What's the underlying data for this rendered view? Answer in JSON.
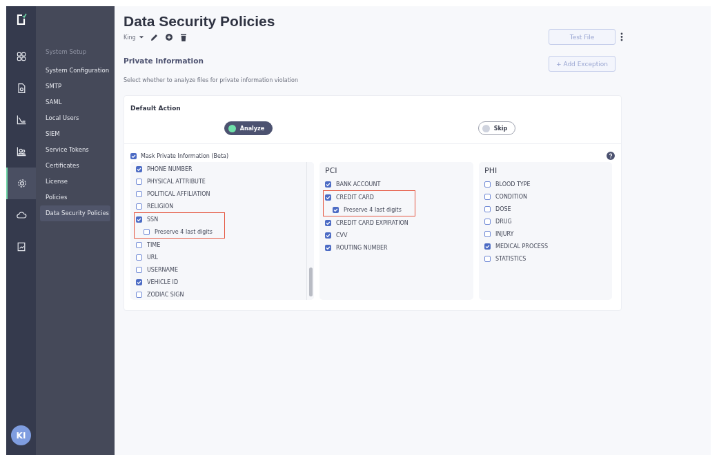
{
  "nav_rail": {
    "items": [
      {
        "selected": false
      },
      {
        "selected": false
      },
      {
        "selected": false
      },
      {
        "selected": false
      },
      {
        "selected": true
      },
      {
        "selected": false
      },
      {
        "selected": false
      }
    ],
    "avatar": "KI"
  },
  "sidebar": {
    "heading": "System Setup",
    "items": [
      {
        "label": "System Configuration",
        "selected": false
      },
      {
        "label": "SMTP",
        "selected": false
      },
      {
        "label": "SAML",
        "selected": false
      },
      {
        "label": "Local Users",
        "selected": false
      },
      {
        "label": "SIEM",
        "selected": false
      },
      {
        "label": "Service Tokens",
        "selected": false
      },
      {
        "label": "Certificates",
        "selected": false
      },
      {
        "label": "License",
        "selected": false
      },
      {
        "label": "Policies",
        "selected": false
      },
      {
        "label": "Data Security Policies",
        "selected": true
      }
    ]
  },
  "page": {
    "title": "Data Security Policies",
    "policy": "King",
    "buttons": {
      "test_file": "Test File",
      "add_exception": "+ Add Exception"
    }
  },
  "section": {
    "title": "Private Information",
    "description": "Select whether to analyze files for private information violation"
  },
  "default_action": {
    "title": "Default Action",
    "options": [
      {
        "label": "Analyze",
        "selected": true
      },
      {
        "label": "Skip",
        "selected": false
      }
    ]
  },
  "mask": {
    "label": "Mask Private Information (Beta)",
    "checked": true
  },
  "groups": [
    {
      "items": [
        {
          "label": "PHONE NUMBER",
          "checked": true,
          "highlighted": false
        },
        {
          "label": "PHYSICAL ATTRIBUTE",
          "checked": false,
          "highlighted": false
        },
        {
          "label": "POLITICAL AFFILIATION",
          "checked": false,
          "highlighted": false
        },
        {
          "label": "RELIGION",
          "checked": false,
          "highlighted": false
        },
        {
          "label": "SSN",
          "checked": true,
          "highlighted": true,
          "sub": {
            "label": "Preserve 4 last digits",
            "checked": false
          }
        },
        {
          "label": "TIME",
          "checked": false,
          "highlighted": false
        },
        {
          "label": "URL",
          "checked": false,
          "highlighted": false
        },
        {
          "label": "USERNAME",
          "checked": false,
          "highlighted": false
        },
        {
          "label": "VEHICLE ID",
          "checked": true,
          "highlighted": false
        },
        {
          "label": "ZODIAC SIGN",
          "checked": false,
          "highlighted": false
        }
      ]
    },
    {
      "title": "PCI",
      "items": [
        {
          "label": "BANK ACCOUNT",
          "checked": true,
          "highlighted": false
        },
        {
          "label": "CREDIT CARD",
          "checked": true,
          "highlighted": true,
          "sub": {
            "label": "Preserve 4 last digits",
            "checked": true
          }
        },
        {
          "label": "CREDIT CARD EXPIRATION",
          "checked": true,
          "highlighted": false
        },
        {
          "label": "CVV",
          "checked": true,
          "highlighted": false
        },
        {
          "label": "ROUTING NUMBER",
          "checked": true,
          "highlighted": false
        }
      ]
    },
    {
      "title": "PHI",
      "items": [
        {
          "label": "BLOOD TYPE",
          "checked": false,
          "highlighted": false
        },
        {
          "label": "CONDITION",
          "checked": false,
          "highlighted": false
        },
        {
          "label": "DOSE",
          "checked": false,
          "highlighted": false
        },
        {
          "label": "DRUG",
          "checked": false,
          "highlighted": false
        },
        {
          "label": "INJURY",
          "checked": false,
          "highlighted": false
        },
        {
          "label": "MEDICAL PROCESS",
          "checked": true,
          "highlighted": false
        },
        {
          "label": "STATISTICS",
          "checked": false,
          "highlighted": false
        }
      ]
    }
  ]
}
